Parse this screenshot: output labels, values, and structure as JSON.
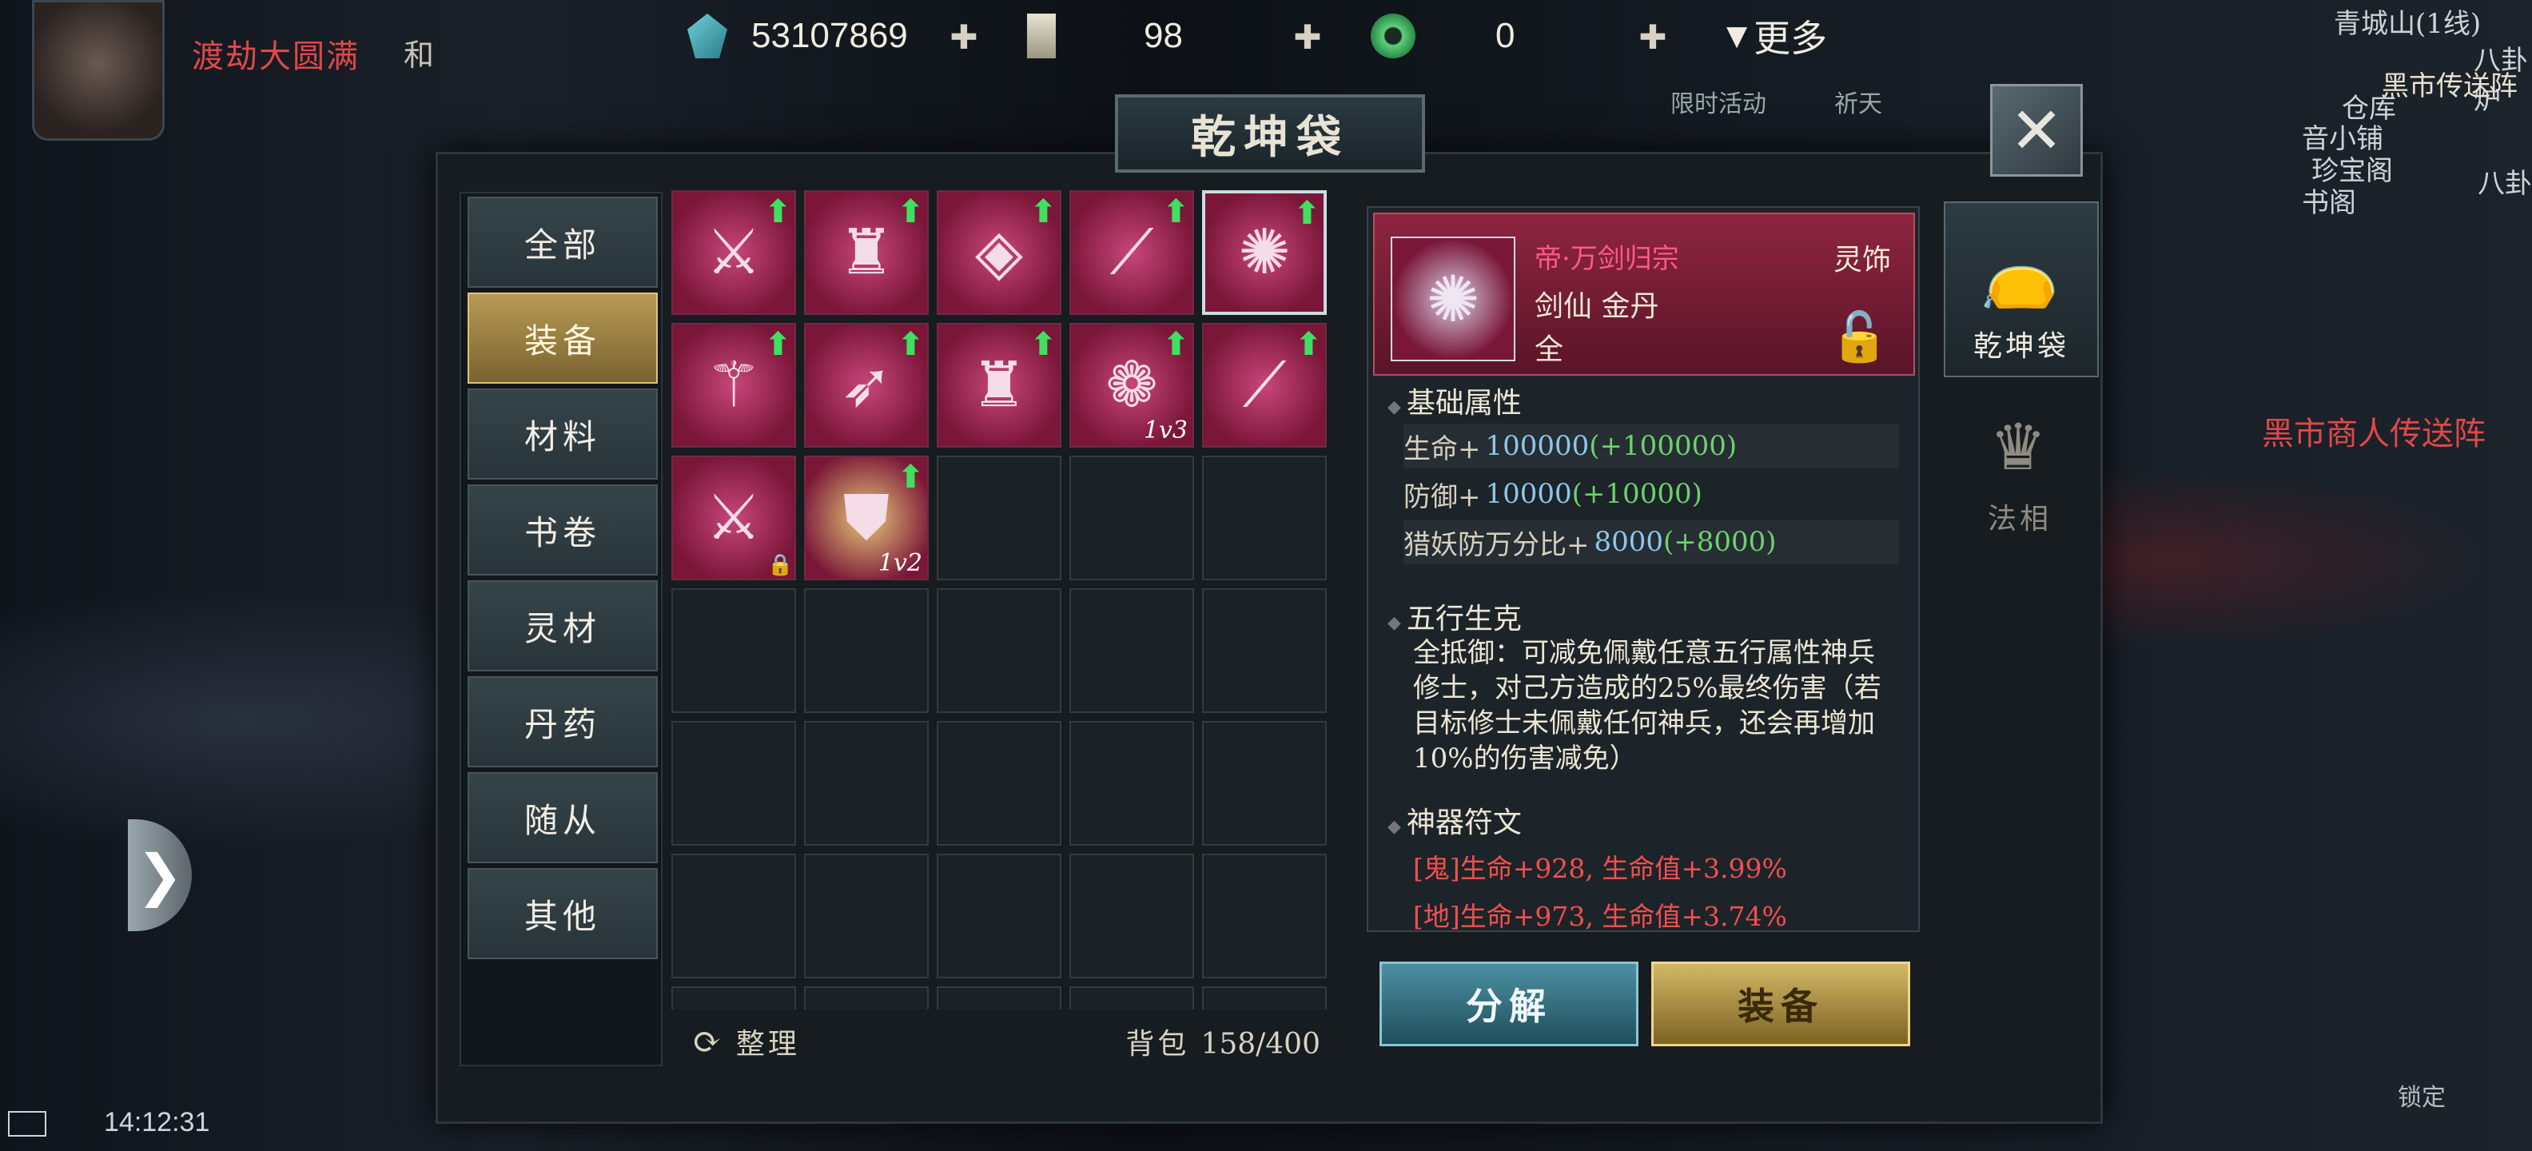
{
  "player": {
    "name": "渡劫大圆满",
    "mode": "和"
  },
  "currencies": [
    {
      "icon": "spirit-stone-icon",
      "value": "53107869"
    },
    {
      "icon": "scroll-icon",
      "value": "98"
    },
    {
      "icon": "jade-coin-icon",
      "value": "0"
    }
  ],
  "more_label": "更多",
  "map": {
    "location": "青城山(1线)",
    "labels": [
      "八卦炉",
      "黑市传送阵",
      "仓库",
      "音小铺",
      "珍宝阁",
      "书阁",
      "八卦",
      "限时活动",
      "祈天",
      "黑市商人传送阵",
      "锁定"
    ]
  },
  "window_title": "乾坤袋",
  "categories": [
    "全部",
    "装备",
    "材料",
    "书卷",
    "灵材",
    "丹药",
    "随从",
    "其他"
  ],
  "active_category": "装备",
  "grid_items": [
    {
      "icon": "ice-trident-icon",
      "glyph": "⚔",
      "upgrade": true,
      "count": "",
      "locked": false,
      "selected": false
    },
    {
      "icon": "red-armor-icon",
      "glyph": "♜",
      "upgrade": true,
      "count": "",
      "locked": false,
      "selected": false
    },
    {
      "icon": "pink-shield-icon",
      "glyph": "◈",
      "upgrade": true,
      "count": "",
      "locked": false,
      "selected": false
    },
    {
      "icon": "claw-icon",
      "glyph": "⟋",
      "upgrade": true,
      "count": "",
      "locked": false,
      "selected": false
    },
    {
      "icon": "sword-wings-ornament-icon",
      "glyph": "✺",
      "upgrade": true,
      "count": "",
      "locked": false,
      "selected": true
    },
    {
      "icon": "staff-icon",
      "glyph": "⚚",
      "upgrade": true,
      "count": "",
      "locked": false,
      "selected": false
    },
    {
      "icon": "flame-arrow-icon",
      "glyph": "➶",
      "upgrade": true,
      "count": "",
      "locked": false,
      "selected": false
    },
    {
      "icon": "red-armor-icon",
      "glyph": "♜",
      "upgrade": true,
      "count": "",
      "locked": false,
      "selected": false
    },
    {
      "icon": "fire-lotus-icon",
      "glyph": "❁",
      "upgrade": true,
      "count": "1v3",
      "locked": false,
      "selected": false
    },
    {
      "icon": "claw-icon",
      "glyph": "⟋",
      "upgrade": true,
      "count": "",
      "locked": false,
      "selected": false
    },
    {
      "icon": "blue-sword-icon",
      "glyph": "⚔",
      "upgrade": false,
      "count": "",
      "locked": true,
      "selected": false
    },
    {
      "icon": "gold-badge-icon",
      "glyph": "⛊",
      "upgrade": true,
      "count": "1v2",
      "locked": false,
      "selected": false
    }
  ],
  "sort_label": "整理",
  "bag_label": "背包",
  "bag_capacity": "158/400",
  "detail": {
    "name": "帝·万剑归宗",
    "type": "灵饰",
    "line2": "剑仙 金丹",
    "line3": "全",
    "base_title": "基础属性",
    "stats": [
      {
        "label": "生命+",
        "value": "100000",
        "bonus": "(+100000)"
      },
      {
        "label": "防御+",
        "value": "10000",
        "bonus": "(+10000)"
      },
      {
        "label": "猎妖防万分比+",
        "value": "8000",
        "bonus": "(+8000)"
      }
    ],
    "wuxing_title": "五行生克",
    "wuxing_text": "全抵御：可减免佩戴任意五行属性神兵修士，对己方造成的25%最终伤害（若目标修士未佩戴任何神兵，还会再增加10%的伤害减免）",
    "rune_title": "神器符文",
    "runes": [
      "[鬼]生命+928, 生命值+3.99%",
      "[地]生命+973, 生命值+3.74%"
    ]
  },
  "buttons": {
    "decompose": "分解",
    "equip": "装备"
  },
  "right_tabs": [
    {
      "icon": "bag-icon",
      "label": "乾坤袋",
      "active": true
    },
    {
      "icon": "dharma-form-icon",
      "label": "法相",
      "active": false
    }
  ],
  "status_bar": {
    "time": "14:12:31"
  }
}
